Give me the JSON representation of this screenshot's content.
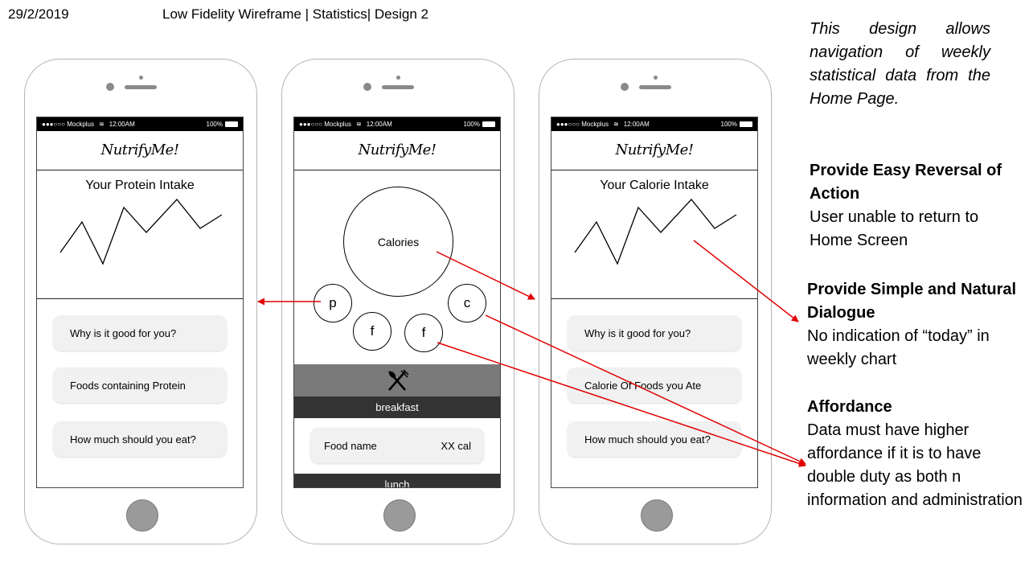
{
  "header": {
    "date": "29/2/2019",
    "title": "Low Fidelity Wireframe  | Statistics| Design 2"
  },
  "status_bar": {
    "carrier": "●●●○○○ Mockplus",
    "time": "12:00AM",
    "battery": "100%"
  },
  "brand": "NutrifyMe!",
  "phone_left": {
    "title": "Your Protein Intake",
    "cards": [
      "Why is it good for you?",
      "Foods containing Protein",
      "How much should you eat?"
    ]
  },
  "phone_center": {
    "big_circle": "Calories",
    "small_circles": [
      "p",
      "f",
      "f",
      "c"
    ],
    "meal_icon": "fork-knife-icon",
    "meal_breakfast": "breakfast",
    "food_name": "Food name",
    "food_cal": "XX cal",
    "meal_lunch": "lunch"
  },
  "phone_right": {
    "title": "Your Calorie Intake",
    "cards": [
      "Why is it good for you?",
      "Calorie Of Foods you Ate",
      "How much should you eat?"
    ]
  },
  "annotations": {
    "intro": "This design allows navigation of weekly statistical data from the Home Page.",
    "reversal_title": "Provide Easy Reversal of Action",
    "reversal_text": "User unable to return to Home Screen",
    "dialogue_title": "Provide Simple and Natural Dialogue",
    "dialogue_text": "No indication of “today” in weekly chart",
    "affordance_title": "Affordance",
    "affordance_text": "Data must have higher affordance if it is to have double duty as both  n information and administration"
  },
  "colors": {
    "arrow": "#e00000",
    "meal_header": "#7a7a7a",
    "meal_bar": "#333333",
    "card_bg": "#f1f1f1"
  }
}
